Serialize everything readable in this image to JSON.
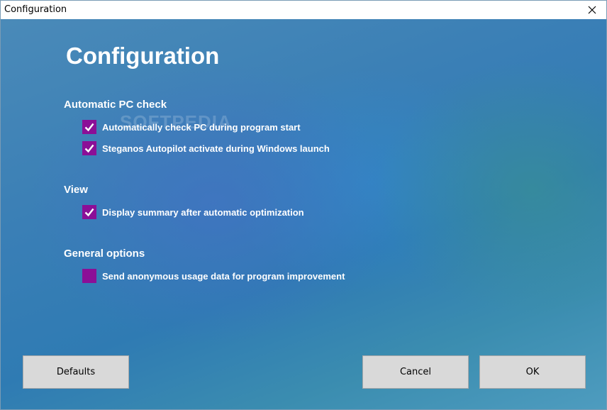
{
  "window": {
    "title": "Configuration",
    "close_icon": "close-icon"
  },
  "heading": "Configuration",
  "watermark": "SOFTPEDIA",
  "sections": [
    {
      "title": "Automatic PC check",
      "options": [
        {
          "label": "Automatically check PC during program start",
          "checked": true
        },
        {
          "label": "Steganos Autopilot activate during Windows launch",
          "checked": true
        }
      ]
    },
    {
      "title": "View",
      "options": [
        {
          "label": "Display summary after automatic optimization",
          "checked": true
        }
      ]
    },
    {
      "title": "General options",
      "options": [
        {
          "label": "Send anonymous usage data for program improvement",
          "checked": false
        }
      ]
    }
  ],
  "buttons": {
    "defaults": "Defaults",
    "cancel": "Cancel",
    "ok": "OK"
  },
  "colors": {
    "checkbox": "#8b0f97",
    "text": "#ffffff",
    "button": "#d9d9d9"
  }
}
